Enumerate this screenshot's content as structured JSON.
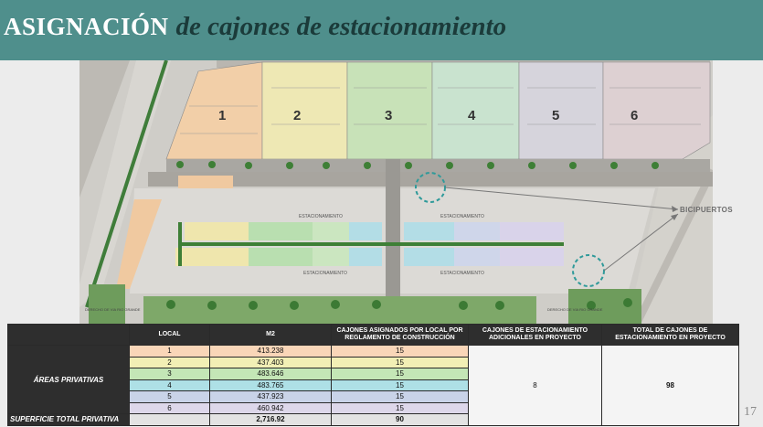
{
  "header": {
    "title_bold": "ASIGNACIÓN",
    "title_italic": "de cajones de estacionamiento"
  },
  "plan": {
    "locales": [
      "1",
      "2",
      "3",
      "4",
      "5",
      "6"
    ],
    "parking_label": "ESTACIONAMIENTO",
    "street_left": "DERECHO DE VIA RIO GRANDE",
    "street_right": "DERECHO DE VIA RIO GRANDE",
    "bicipuertos": "BICIPUERTOS"
  },
  "table": {
    "headers": {
      "local": "LOCAL",
      "m2": "M2",
      "cajones_reglamento": "CAJONES ASIGNADOS POR LOCAL POR REGLAMENTO DE CONSTRUCCIÓN",
      "cajones_adicionales": "CAJONES DE ESTACIONAMIENTO ADICIONALES EN PROYECTO",
      "total_cajones": "TOTAL DE CAJONES DE ESTACIONAMIENTO EN PROYECTO"
    },
    "section_label": "ÁREAS PRIVATIVAS",
    "rows": [
      {
        "local": "1",
        "m2": "413.238",
        "cajones": "15"
      },
      {
        "local": "2",
        "m2": "437.403",
        "cajones": "15"
      },
      {
        "local": "3",
        "m2": "483.646",
        "cajones": "15"
      },
      {
        "local": "4",
        "m2": "483.765",
        "cajones": "15"
      },
      {
        "local": "5",
        "m2": "437.923",
        "cajones": "15"
      },
      {
        "local": "6",
        "m2": "460.942",
        "cajones": "15"
      }
    ],
    "adicionales": "8",
    "total_proyecto": "98",
    "total_label": "SUPERFICIE TOTAL PRIVATIVA",
    "total_m2": "2,716.92",
    "total_cajones": "90"
  },
  "page_number": "17"
}
